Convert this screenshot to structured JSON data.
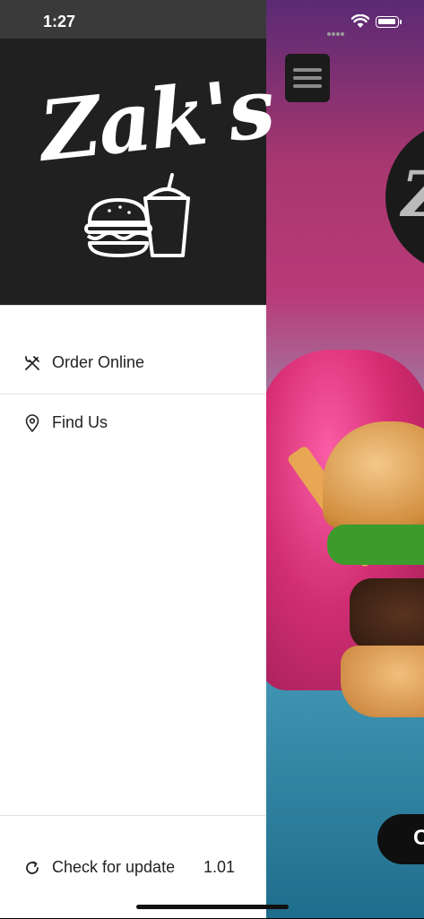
{
  "status": {
    "time": "1:27"
  },
  "brand": {
    "name": "Zak's"
  },
  "menu": {
    "items": [
      {
        "label": "Order Online",
        "icon": "utensils-icon"
      },
      {
        "label": "Find Us",
        "icon": "location-pin-icon"
      }
    ]
  },
  "footer": {
    "update_label": "Check for update",
    "version": "1.01"
  },
  "background": {
    "logo_fragment": "Z",
    "cta_fragment": "C"
  }
}
